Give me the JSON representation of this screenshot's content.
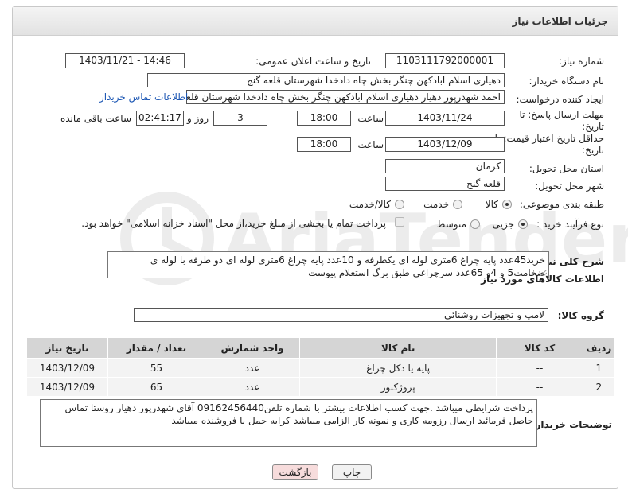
{
  "header": {
    "title": "جزئیات اطلاعات نیاز"
  },
  "fields": {
    "need_number_label": "شماره نیاز:",
    "need_number": "1103111792000001",
    "announce_label": "تاریخ و ساعت اعلان عمومی:",
    "announce_value": "1403/11/21 - 14:46",
    "buyer_org_label": "نام دستگاه خریدار:",
    "buyer_org": "دهیاری اسلام ابادکهن چنگر بخش چاه دادخدا شهرستان قلعه گنج",
    "creator_label": "ایجاد کننده درخواست:",
    "creator": "احمد شهدرپور دهیار دهیاری اسلام ابادکهن چنگر بخش چاه دادخدا شهرستان قلعه گنج",
    "contact_link": "اطلاعات تماس خریدار",
    "deadline_label_1": "مهلت ارسال پاسخ: تا",
    "deadline_label_2": "تاریخ:",
    "deadline_date": "1403/11/24",
    "time_label": "ساعت",
    "deadline_time": "18:00",
    "days_value": "3",
    "days_label": "روز و",
    "remaining_time": "02:41:17",
    "remaining_label": "ساعت باقی مانده",
    "validity_label_1": "حداقل تاریخ اعتبار قیمت: تا",
    "validity_label_2": "تاریخ:",
    "validity_date": "1403/12/09",
    "validity_time": "18:00",
    "province_label": "استان محل تحویل:",
    "province": "کرمان",
    "city_label": "شهر محل تحویل:",
    "city": "قلعه گنج",
    "category_label": "طبقه بندی موضوعی:",
    "category_options": [
      "کالا",
      "خدمت",
      "کالا/خدمت"
    ],
    "category_selected": "کالا",
    "process_label": "نوع فرآیند خرید :",
    "process_options": [
      "جزیی",
      "متوسط"
    ],
    "process_selected": "جزیی",
    "payment_note": "پرداخت تمام یا بخشی از مبلغ خرید،از محل \"اسناد خزانه اسلامی\" خواهد بود."
  },
  "description": {
    "label": "شرح کلی نیاز:",
    "text": "خرید45عدد پایه چراغ 6متری لوله ای یکطرفه و 10عدد پایه چراغ 6متری لوله ای دو طرفه با لوله ی ضخامت5 و 4و 65عدد سرچراغی طبق برگ استعلام پیوست"
  },
  "goods": {
    "section_title": "اطلاعات کالاهای مورد نیاز",
    "group_label": "گروه کالا:",
    "group_value": "لامپ و تجهیزات روشنائی",
    "columns": [
      "ردیف",
      "کد کالا",
      "نام کالا",
      "واحد شمارش",
      "تعداد / مقدار",
      "تاریخ نیاز"
    ],
    "rows": [
      [
        "1",
        "--",
        "پایه یا دکل چراغ",
        "عدد",
        "55",
        "1403/12/09"
      ],
      [
        "2",
        "--",
        "پروژکتور",
        "عدد",
        "65",
        "1403/12/09"
      ]
    ]
  },
  "buyer_notes": {
    "label": "توضیحات خریدار:",
    "text": "پرداخت شرایطی میباشد .جهت کسب اطلاعات بیشتر با شماره تلفن09162456440 آقای شهدرپور دهیار روستا تماس حاصل فرمائید ارسال رزومه کاری و نمونه کار الزامی میباشد-کرایه حمل با فروشنده میباشد"
  },
  "buttons": {
    "print": "چاپ",
    "back": "بازگشت"
  },
  "watermark": "AriaTender.net",
  "colors": {
    "link": "#1a55b3",
    "back_button_bg": "#f7dcdc",
    "header_bg": "#e9e9e9"
  }
}
